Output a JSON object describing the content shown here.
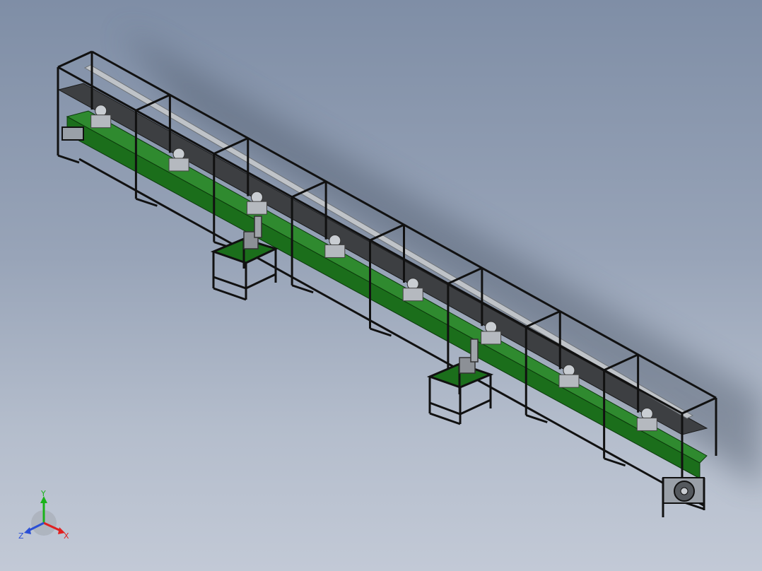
{
  "window": {
    "view_type": "isometric 3D assembly view",
    "background_top": "#7f8ea6",
    "background_bottom": "#c2c9d6"
  },
  "assembly": {
    "name": "",
    "station_count": 8,
    "side_bench_count": 2,
    "colors": {
      "frame": "#111111",
      "belt": "#1b6e1b",
      "belt_dark": "#125512",
      "shelf": "#3d3f42",
      "rail": "#bfc3c8",
      "fixture": "#c9cdd2"
    }
  },
  "triad": {
    "x_label": "X",
    "y_label": "Y",
    "z_label": "Z",
    "x_color": "#e02020",
    "y_color": "#19b319",
    "z_color": "#2a4fd6"
  }
}
